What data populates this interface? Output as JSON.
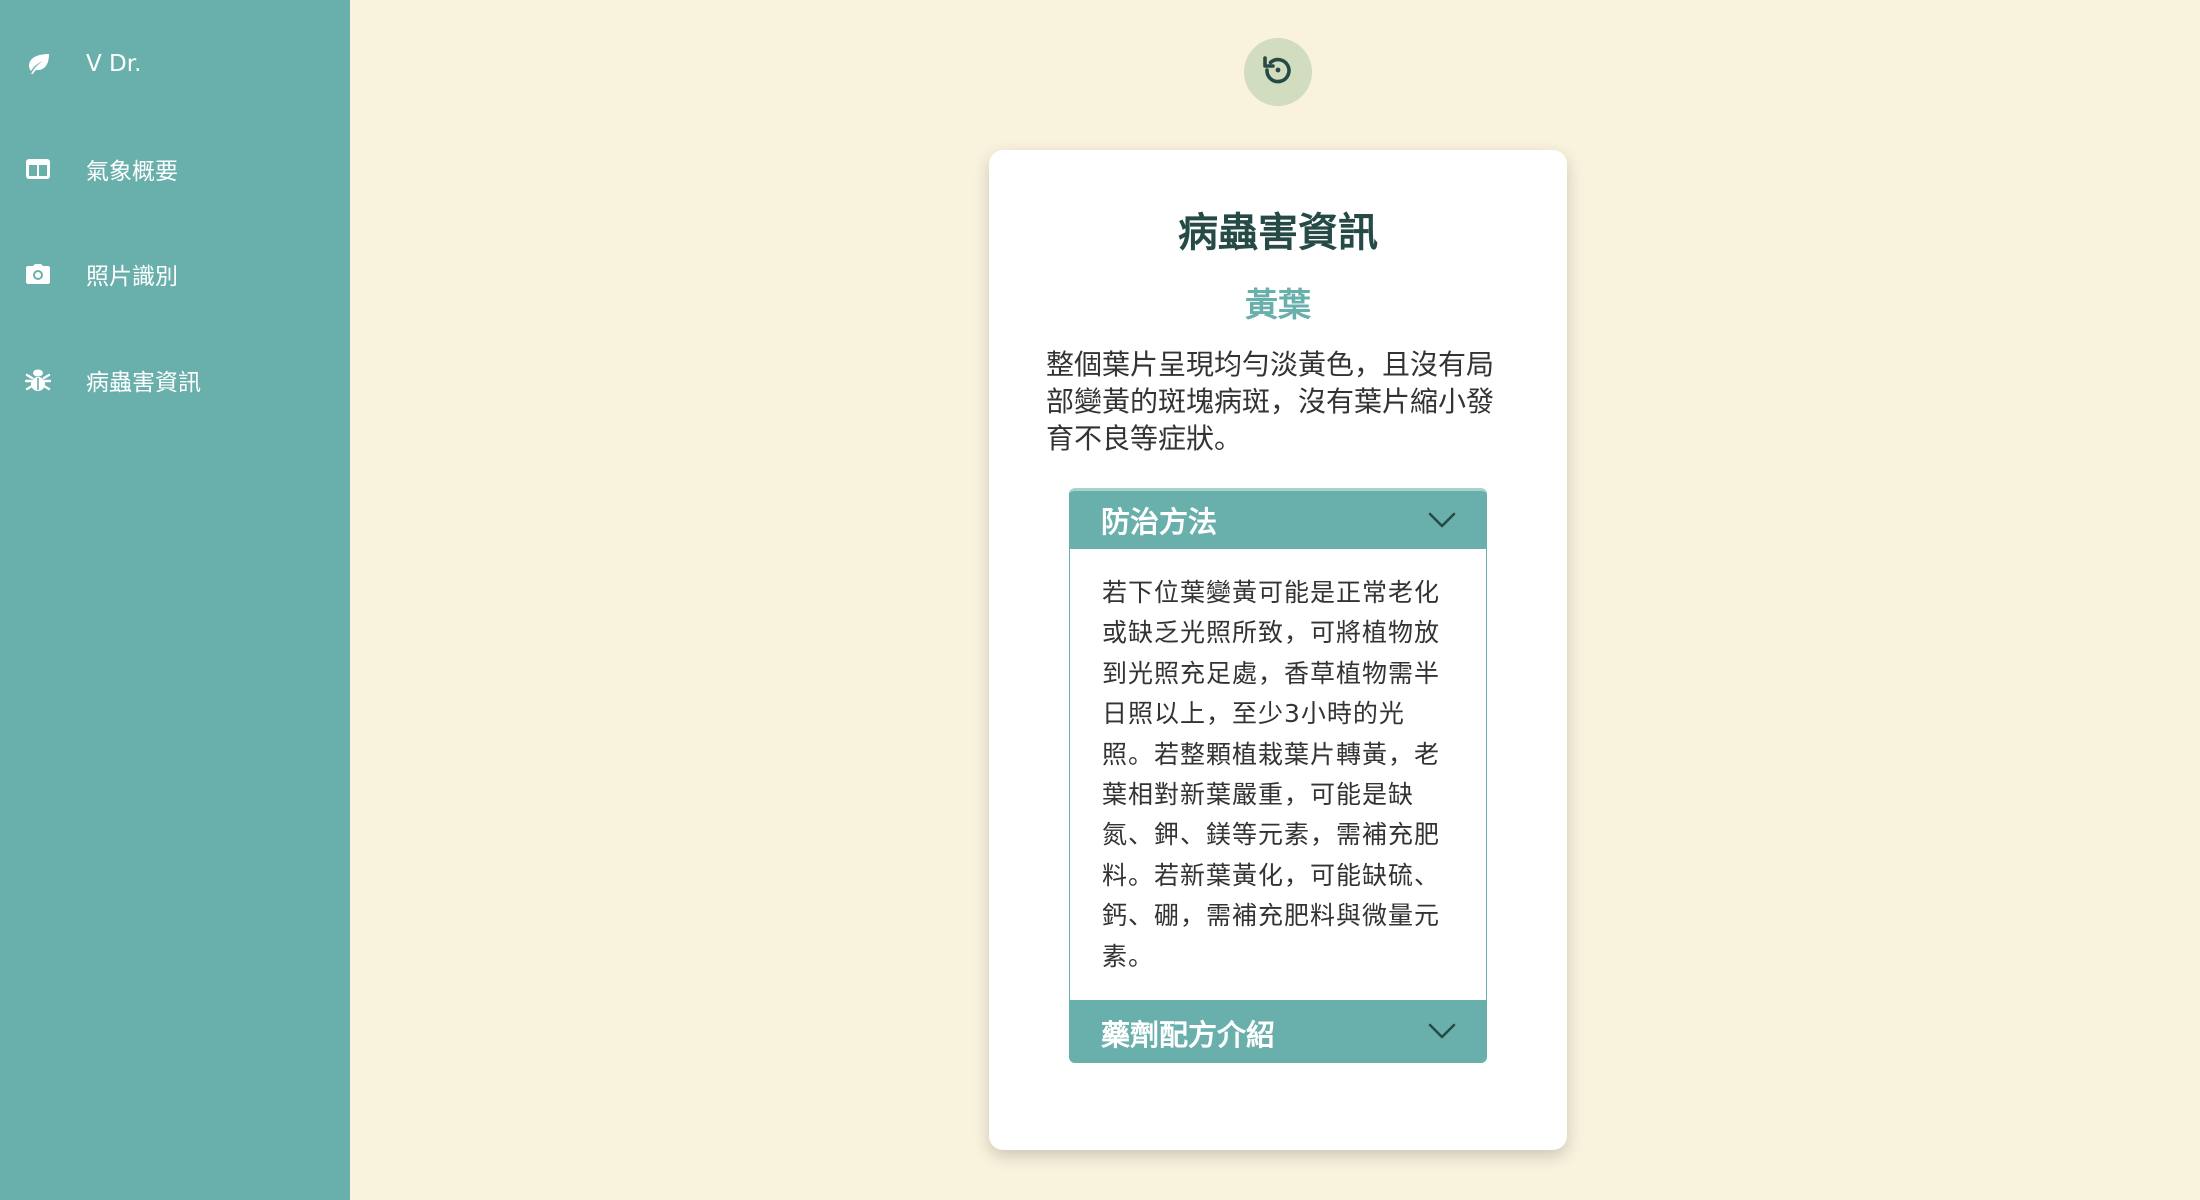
{
  "sidebar": {
    "brand": {
      "label": "V Dr.",
      "icon": "leaf-icon"
    },
    "items": [
      {
        "label": "氣象概要",
        "icon": "panel-icon"
      },
      {
        "label": "照片識別",
        "icon": "camera-icon"
      },
      {
        "label": "病蟲害資訊",
        "icon": "bug-icon"
      }
    ]
  },
  "toolbar": {
    "reset_icon": "reset-icon"
  },
  "card": {
    "title": "病蟲害資訊",
    "subtitle": "黃葉",
    "description": "整個葉片呈現均勻淡黃色，且沒有局部變黃的斑塊病斑，沒有葉片縮小發育不良等症狀。",
    "sections": [
      {
        "title": "防治方法",
        "expanded": true,
        "body": "若下位葉變黃可能是正常老化或缺乏光照所致，可將植物放到光照充足處，香草植物需半日照以上，至少3小時的光照。若整顆植栽葉片轉黃，老葉相對新葉嚴重，可能是缺氮、鉀、鎂等元素，需補充肥料。若新葉黃化，可能缺硫、鈣、硼，需補充肥料與微量元素。"
      },
      {
        "title": "藥劑配方介紹",
        "expanded": false,
        "body": ""
      }
    ]
  },
  "colors": {
    "sidebar": "#69b0ac",
    "background": "#f9f2dd",
    "title": "#264b47",
    "accent": "#69b0ac",
    "reset_button": "#d2dcbf"
  }
}
